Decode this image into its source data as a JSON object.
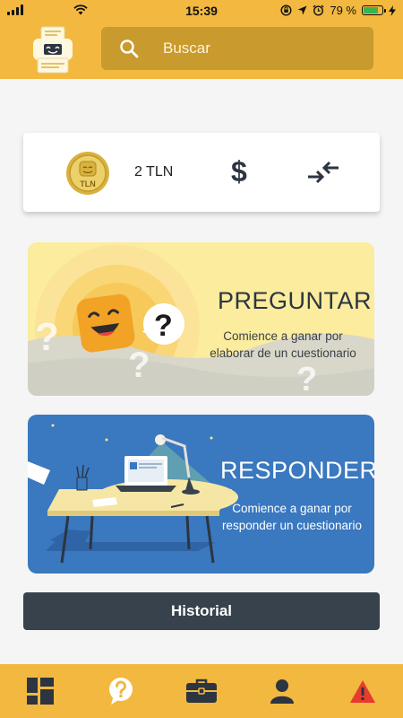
{
  "status_bar": {
    "time": "15:39",
    "battery_percent": "79 %",
    "battery_level": 0.79,
    "icons": [
      "signal-icon",
      "wifi-icon",
      "screen-lock-icon",
      "location-icon",
      "alarm-icon",
      "battery-icon",
      "charging-icon"
    ]
  },
  "header": {
    "logo_icon": "printer-logo-icon",
    "search_placeholder": "Buscar"
  },
  "coins": {
    "coin_label": "TLN",
    "amount": "2 TLN",
    "dollar_symbol": "$"
  },
  "cards": {
    "ask": {
      "title": "PREGUNTAR",
      "subtitle": "Comience a ganar por elaborar de un cuestionario"
    },
    "answer": {
      "title": "RESPONDER",
      "subtitle": "Comience a ganar por responder un cuestionario"
    }
  },
  "history_label": "Historial",
  "bottom_nav": {
    "items": [
      "dashboard-icon",
      "question-icon",
      "briefcase-icon",
      "user-icon",
      "warning-icon"
    ]
  },
  "colors": {
    "brand_yellow": "#f2b83f",
    "search_bg": "#c99a2e",
    "dark": "#37424c",
    "answer_blue": "#3a78bf",
    "ask_yellow": "#fbec9e",
    "warning_red": "#e63b2e"
  }
}
